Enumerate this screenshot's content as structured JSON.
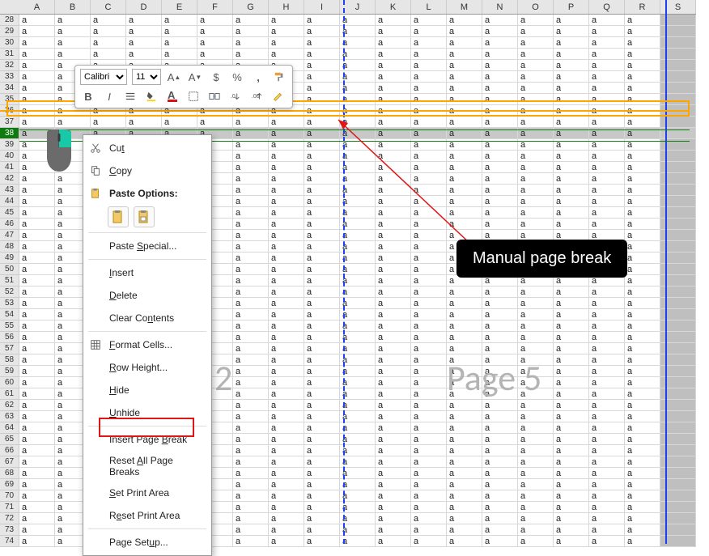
{
  "columns": [
    "A",
    "B",
    "C",
    "D",
    "E",
    "F",
    "G",
    "H",
    "I",
    "J",
    "K",
    "L",
    "M",
    "N",
    "O",
    "P",
    "Q",
    "R",
    "S"
  ],
  "row_start": 28,
  "row_end": 74,
  "selected_row": 38,
  "cell_value": "a",
  "filled_cols": 18,
  "watermarks": {
    "left": "2",
    "right": "Page 5"
  },
  "mini_toolbar": {
    "font": "Calibri",
    "size": "11",
    "buttons": [
      "increase-font",
      "decrease-font",
      "accounting",
      "percent",
      "comma",
      "format-painter",
      "bold",
      "italic",
      "underline",
      "fill-color",
      "font-color",
      "borders",
      "merge",
      "decimal-inc",
      "decimal-dec"
    ]
  },
  "context_menu": {
    "items": [
      {
        "id": "cut",
        "label": "Cut",
        "icon": "scissors"
      },
      {
        "id": "copy",
        "label": "Copy",
        "icon": "copy"
      },
      {
        "id": "paste-options",
        "label": "Paste Options:",
        "icon": "paste",
        "bold": true,
        "type": "paste-header"
      },
      {
        "id": "paste-opts-row",
        "type": "paste-opts"
      },
      {
        "id": "sep1",
        "type": "sep"
      },
      {
        "id": "paste-special",
        "label": "Paste Special..."
      },
      {
        "id": "sep2",
        "type": "sep"
      },
      {
        "id": "insert",
        "label": "Insert"
      },
      {
        "id": "delete",
        "label": "Delete"
      },
      {
        "id": "clear",
        "label": "Clear Contents"
      },
      {
        "id": "sep3",
        "type": "sep"
      },
      {
        "id": "format-cells",
        "label": "Format Cells...",
        "icon": "format-cells"
      },
      {
        "id": "row-height",
        "label": "Row Height..."
      },
      {
        "id": "hide",
        "label": "Hide"
      },
      {
        "id": "unhide",
        "label": "Unhide"
      },
      {
        "id": "sep4",
        "type": "sep"
      },
      {
        "id": "insert-page-break",
        "label": "Insert Page Break",
        "highlight": true
      },
      {
        "id": "reset-breaks",
        "label": "Reset All Page Breaks"
      },
      {
        "id": "set-print-area",
        "label": "Set Print Area"
      },
      {
        "id": "reset-print-area",
        "label": "Reset Print Area"
      },
      {
        "id": "sep5",
        "type": "sep"
      },
      {
        "id": "page-setup",
        "label": "Page Setup..."
      }
    ]
  },
  "annotation": {
    "label": "Manual page break"
  }
}
